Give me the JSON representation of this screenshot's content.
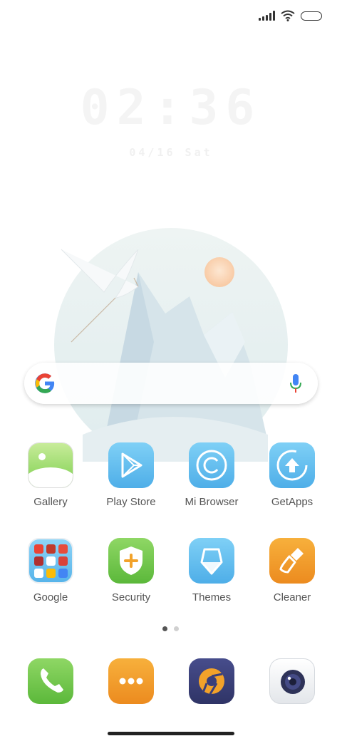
{
  "clock": {
    "time": "02:36",
    "date": "04/16 Sat"
  },
  "status": {
    "icons": [
      "signal-icon",
      "wifi-icon",
      "battery-icon"
    ]
  },
  "search": {
    "icons": [
      "google-g-icon",
      "mic-icon"
    ]
  },
  "apps": [
    {
      "label": "Gallery"
    },
    {
      "label": "Play Store"
    },
    {
      "label": "Mi Browser"
    },
    {
      "label": "GetApps"
    },
    {
      "label": "Google"
    },
    {
      "label": "Security"
    },
    {
      "label": "Themes"
    },
    {
      "label": "Cleaner"
    }
  ],
  "dock": [
    "phone-icon",
    "more-icon",
    "browser-icon",
    "camera-icon"
  ],
  "pager": {
    "pages": 2,
    "current": 1
  },
  "colors": {
    "green": "#6ec24a",
    "blue": "#5ab8ee",
    "orange": "#f2a22a",
    "navy": "#3a3f7a"
  }
}
